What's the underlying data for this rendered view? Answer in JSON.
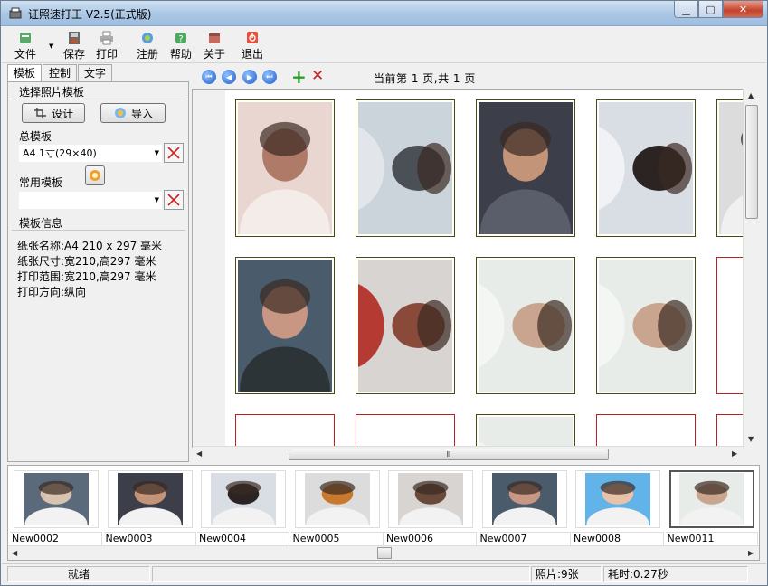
{
  "window": {
    "title": "证照速打王 V2.5(正式版)",
    "controls": {
      "minimize": "▁",
      "maximize": "▢",
      "close": "✕"
    }
  },
  "toolbar": {
    "items": [
      {
        "label": "文件",
        "icon": "file-icon",
        "color": "#2e8b57"
      },
      {
        "label": "保存",
        "icon": "save-icon",
        "color": "#555555"
      },
      {
        "label": "打印",
        "icon": "print-icon",
        "color": "#8a8a8a"
      },
      {
        "label": "注册",
        "icon": "register-icon",
        "color": "#2f7fd0"
      },
      {
        "label": "帮助",
        "icon": "help-icon",
        "color": "#2e8b57"
      },
      {
        "label": "关于",
        "icon": "about-icon",
        "color": "#b0605a"
      },
      {
        "label": "退出",
        "icon": "exit-icon",
        "color": "#e04a3a"
      }
    ]
  },
  "left_panel": {
    "tabs": [
      "模板",
      "控制",
      "文字"
    ],
    "photo_template_group": "选择照片模板",
    "design_button": "设计",
    "import_button": "导入",
    "total_template_label": "总模板",
    "total_template_value": "A4 1寸(29×40)",
    "common_template_label": "常用模板",
    "common_template_value": "",
    "info_group": "模板信息",
    "info_lines": [
      "纸张名称:A4 210 x 297 毫米",
      "纸张尺寸:宽210,高297 毫米",
      "打印范围:宽210,高297 毫米",
      "打印方向:纵向"
    ]
  },
  "nav": {
    "first": "⏮",
    "prev": "◀",
    "next": "▶",
    "last": "⏭",
    "add": "+",
    "delete": "✕",
    "page_info": "当前第 1 页,共 1 页"
  },
  "canvas": {
    "hscroll_grip": "Ⅲ",
    "filled_slots": [
      {
        "tone": [
          "#e9d6d0",
          "#b07a68",
          "#f3ece8"
        ]
      },
      {
        "tone": [
          "#cbd3db",
          "#4b4f56",
          "#e2e6ea"
        ]
      },
      {
        "tone": [
          "#3c3f49",
          "#c49478",
          "#5a5e6a"
        ]
      },
      {
        "tone": [
          "#d9dde4",
          "#2b2422",
          "#f0f2f5"
        ]
      },
      {
        "tone": [
          "#dcdcdc",
          "#c8792e",
          "#f0f0f0"
        ]
      },
      {
        "tone": [
          "#4a5c6b",
          "#c79784",
          "#2c3438"
        ]
      },
      {
        "tone": [
          "#d8d4d2",
          "#8a4a3a",
          "#b53a32"
        ]
      },
      {
        "tone": [
          "#e8ece8",
          "#c9a48e",
          "#f4f6f4"
        ]
      },
      {
        "tone": [
          "#e8ece8",
          "#c9a48e",
          "#f4f6f4"
        ]
      },
      {
        "tone": [
          "#e8ece8",
          "#c9a48e",
          "#f4f6f4"
        ]
      }
    ]
  },
  "thumbnails": [
    {
      "name": "New0002",
      "tone": [
        "#5a6a7a",
        "#d8c2b0"
      ]
    },
    {
      "name": "New0003",
      "tone": [
        "#3c3f49",
        "#c49478"
      ]
    },
    {
      "name": "New0004",
      "tone": [
        "#d9dde4",
        "#2b2422"
      ]
    },
    {
      "name": "New0005",
      "tone": [
        "#dcdcdc",
        "#c8792e"
      ]
    },
    {
      "name": "New0006",
      "tone": [
        "#d8d4d2",
        "#6a4a3a"
      ]
    },
    {
      "name": "New0007",
      "tone": [
        "#4a5c6b",
        "#c79784"
      ]
    },
    {
      "name": "New0008",
      "tone": [
        "#62b3e8",
        "#e8c2a8"
      ]
    },
    {
      "name": "New0011",
      "tone": [
        "#e8ece8",
        "#c9a48e"
      ]
    }
  ],
  "status": {
    "state": "就绪",
    "photos": "照片:9张",
    "elapsed": "耗时:0.27秒"
  }
}
